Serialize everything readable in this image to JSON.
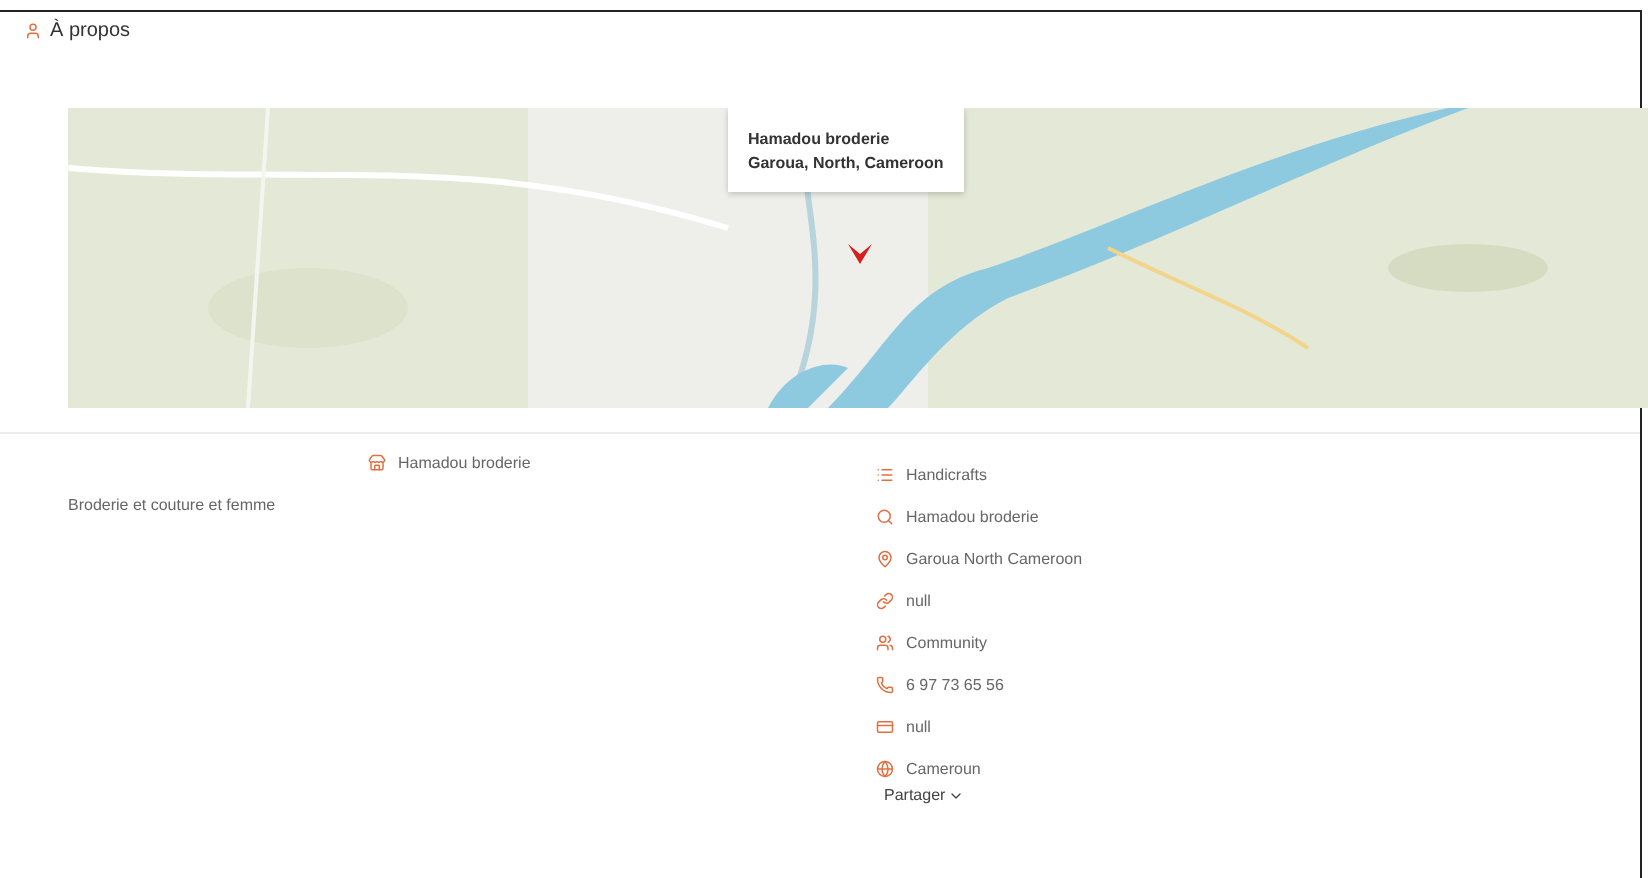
{
  "header": {
    "title": "À propos"
  },
  "map": {
    "kind": "picture",
    "popup": {
      "name": "Hamadou broderie",
      "address": "Garoua, North, Cameroon"
    }
  },
  "business": {
    "name": "Hamadou broderie",
    "description": "Broderie et couture et femme"
  },
  "details": [
    {
      "kind": "category",
      "text": "Handicrafts"
    },
    {
      "kind": "search",
      "text": "Hamadou broderie"
    },
    {
      "kind": "location",
      "text": "Garoua North Cameroon"
    },
    {
      "kind": "link",
      "text": "null"
    },
    {
      "kind": "people",
      "text": "Community"
    },
    {
      "kind": "phone",
      "text": "6 97 73 65 56"
    },
    {
      "kind": "card",
      "text": "null"
    },
    {
      "kind": "globe",
      "text": "Cameroun"
    }
  ],
  "dropdown": {
    "label": "Partager"
  }
}
